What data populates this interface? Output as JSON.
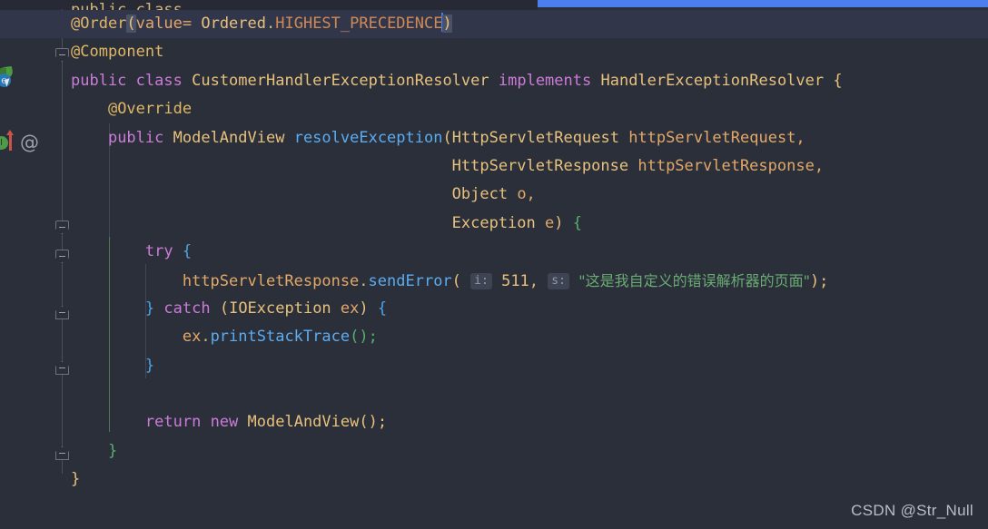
{
  "editor": {
    "language": "java",
    "theme": "darcula",
    "background": "#2b2f3a",
    "caret_line_background": "#32364a",
    "accent_blue": "#4b7fee",
    "top_strip": {
      "name": "selection-strip",
      "color": "#4b7fee"
    },
    "clipped_top_line": "public class ... ,"
  },
  "gutter": {
    "icons": [
      {
        "name": "spring-bean-icon",
        "tooltip": "Spring Bean"
      },
      {
        "name": "implementing-method-icon",
        "letter": "I",
        "tooltip": "Implements method in HandlerExceptionResolver"
      },
      {
        "name": "annotation-icon",
        "glyph": "@",
        "tooltip": "Annotation"
      }
    ],
    "fold_markers": [
      {
        "name": "fold-marker-order",
        "state": "expanded"
      },
      {
        "name": "fold-marker-component",
        "state": "expanded"
      },
      {
        "name": "fold-marker-class",
        "state": "expanded"
      },
      {
        "name": "fold-marker-method",
        "state": "expanded"
      },
      {
        "name": "fold-marker-try",
        "state": "expanded"
      },
      {
        "name": "fold-marker-catch",
        "state": "expanded"
      },
      {
        "name": "fold-marker-method-end",
        "state": "expanded"
      }
    ]
  },
  "hints": {
    "int_param": "i:",
    "string_param": "s:"
  },
  "code_lines": [
    {
      "id": "line-order",
      "caret": true,
      "text": "@Order(value= Ordered.HIGHEST_PRECEDENCE)"
    },
    {
      "id": "line-component",
      "text": "@Component"
    },
    {
      "id": "line-class-decl",
      "text": "public class CustomerHandlerExceptionResolver implements HandlerExceptionResolver {"
    },
    {
      "id": "line-override",
      "text": "    @Override"
    },
    {
      "id": "line-method-decl",
      "text": "    public ModelAndView resolveException(HttpServletRequest httpServletRequest,"
    },
    {
      "id": "line-param-response",
      "text": "                                         HttpServletResponse httpServletResponse,"
    },
    {
      "id": "line-param-object",
      "text": "                                         Object o,"
    },
    {
      "id": "line-param-exception",
      "text": "                                         Exception e) {"
    },
    {
      "id": "line-try",
      "text": "        try {"
    },
    {
      "id": "line-send-error",
      "text": "            httpServletResponse.sendError( i: 511,  s: \"这是我自定义的错误解析器的页面\");"
    },
    {
      "id": "line-catch",
      "text": "        } catch (IOException ex) {"
    },
    {
      "id": "line-print-stack",
      "text": "            ex.printStackTrace();"
    },
    {
      "id": "line-catch-close",
      "text": "        }"
    },
    {
      "id": "line-blank",
      "text": ""
    },
    {
      "id": "line-return",
      "text": "        return new ModelAndView();"
    },
    {
      "id": "line-method-close",
      "text": "    }"
    },
    {
      "id": "line-class-close",
      "text": "}"
    }
  ],
  "tokens": {
    "at_order": "@Order",
    "paren_open": "(",
    "value_eq": "value=",
    "ordered": "Ordered",
    "dot": ".",
    "highest_precedence": "HIGHEST_PRECEDENCE",
    "paren_close": ")",
    "at_component": "@Component",
    "public": "public",
    "class": "class",
    "class_name": "CustomerHandlerExceptionResolver",
    "implements": "implements",
    "interface_name": "HandlerExceptionResolver",
    "brace_open": "{",
    "at_override": "@Override",
    "return_type": "ModelAndView",
    "method_name": "resolveException",
    "type_request": "HttpServletRequest",
    "arg_request": "httpServletRequest,",
    "type_response": "HttpServletResponse",
    "arg_response": "httpServletResponse,",
    "type_object": "Object",
    "arg_object": "o,",
    "type_exception": "Exception",
    "arg_exception": "e",
    "try": "try",
    "obj_response": "httpServletResponse",
    "send_error": "sendError",
    "code_511": "511",
    "comma": ",",
    "cn_message": "\"这是我自定义的错误解析器的页面\"",
    "semicolon": ");",
    "brace_close": "}",
    "catch": "catch",
    "io_exception": "IOException",
    "ex": "ex",
    "print_stack_trace": "printStackTrace",
    "empty_parens": "();",
    "return": "return",
    "new": "new",
    "model_and_view": "ModelAndView"
  },
  "watermark": {
    "text": "CSDN @Str_Null"
  }
}
